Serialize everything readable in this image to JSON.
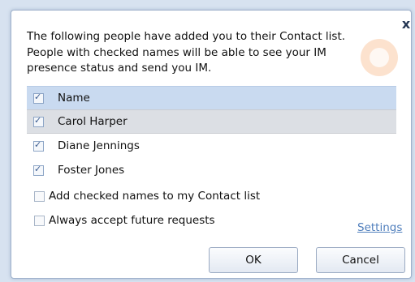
{
  "dialog": {
    "message_lines": [
      "The following people have added you to their Contact list.",
      "People with checked names will be able to see your IM",
      "presence status and send you IM."
    ],
    "close_glyph": "x"
  },
  "list": {
    "header": {
      "label": "Name",
      "checked": true
    },
    "contacts": [
      {
        "name": "Carol Harper",
        "checked": true,
        "selected": true
      },
      {
        "name": "Diane Jennings",
        "checked": true,
        "selected": false
      },
      {
        "name": "Foster Jones",
        "checked": true,
        "selected": false
      }
    ]
  },
  "options": {
    "add_to_contacts": {
      "label": "Add checked names to my Contact list",
      "checked": false
    },
    "always_accept": {
      "label": "Always accept future requests",
      "checked": false
    }
  },
  "settings_link": "Settings",
  "buttons": {
    "ok": "OK",
    "cancel": "Cancel"
  },
  "icons": {
    "close": "close-icon",
    "checkbox": "checkbox-icon",
    "watermark": "brand-logo-icon"
  },
  "colors": {
    "header_bg": "#c9daf0",
    "selected_row_bg": "#dcdfe4",
    "link": "#4f7ebc"
  }
}
